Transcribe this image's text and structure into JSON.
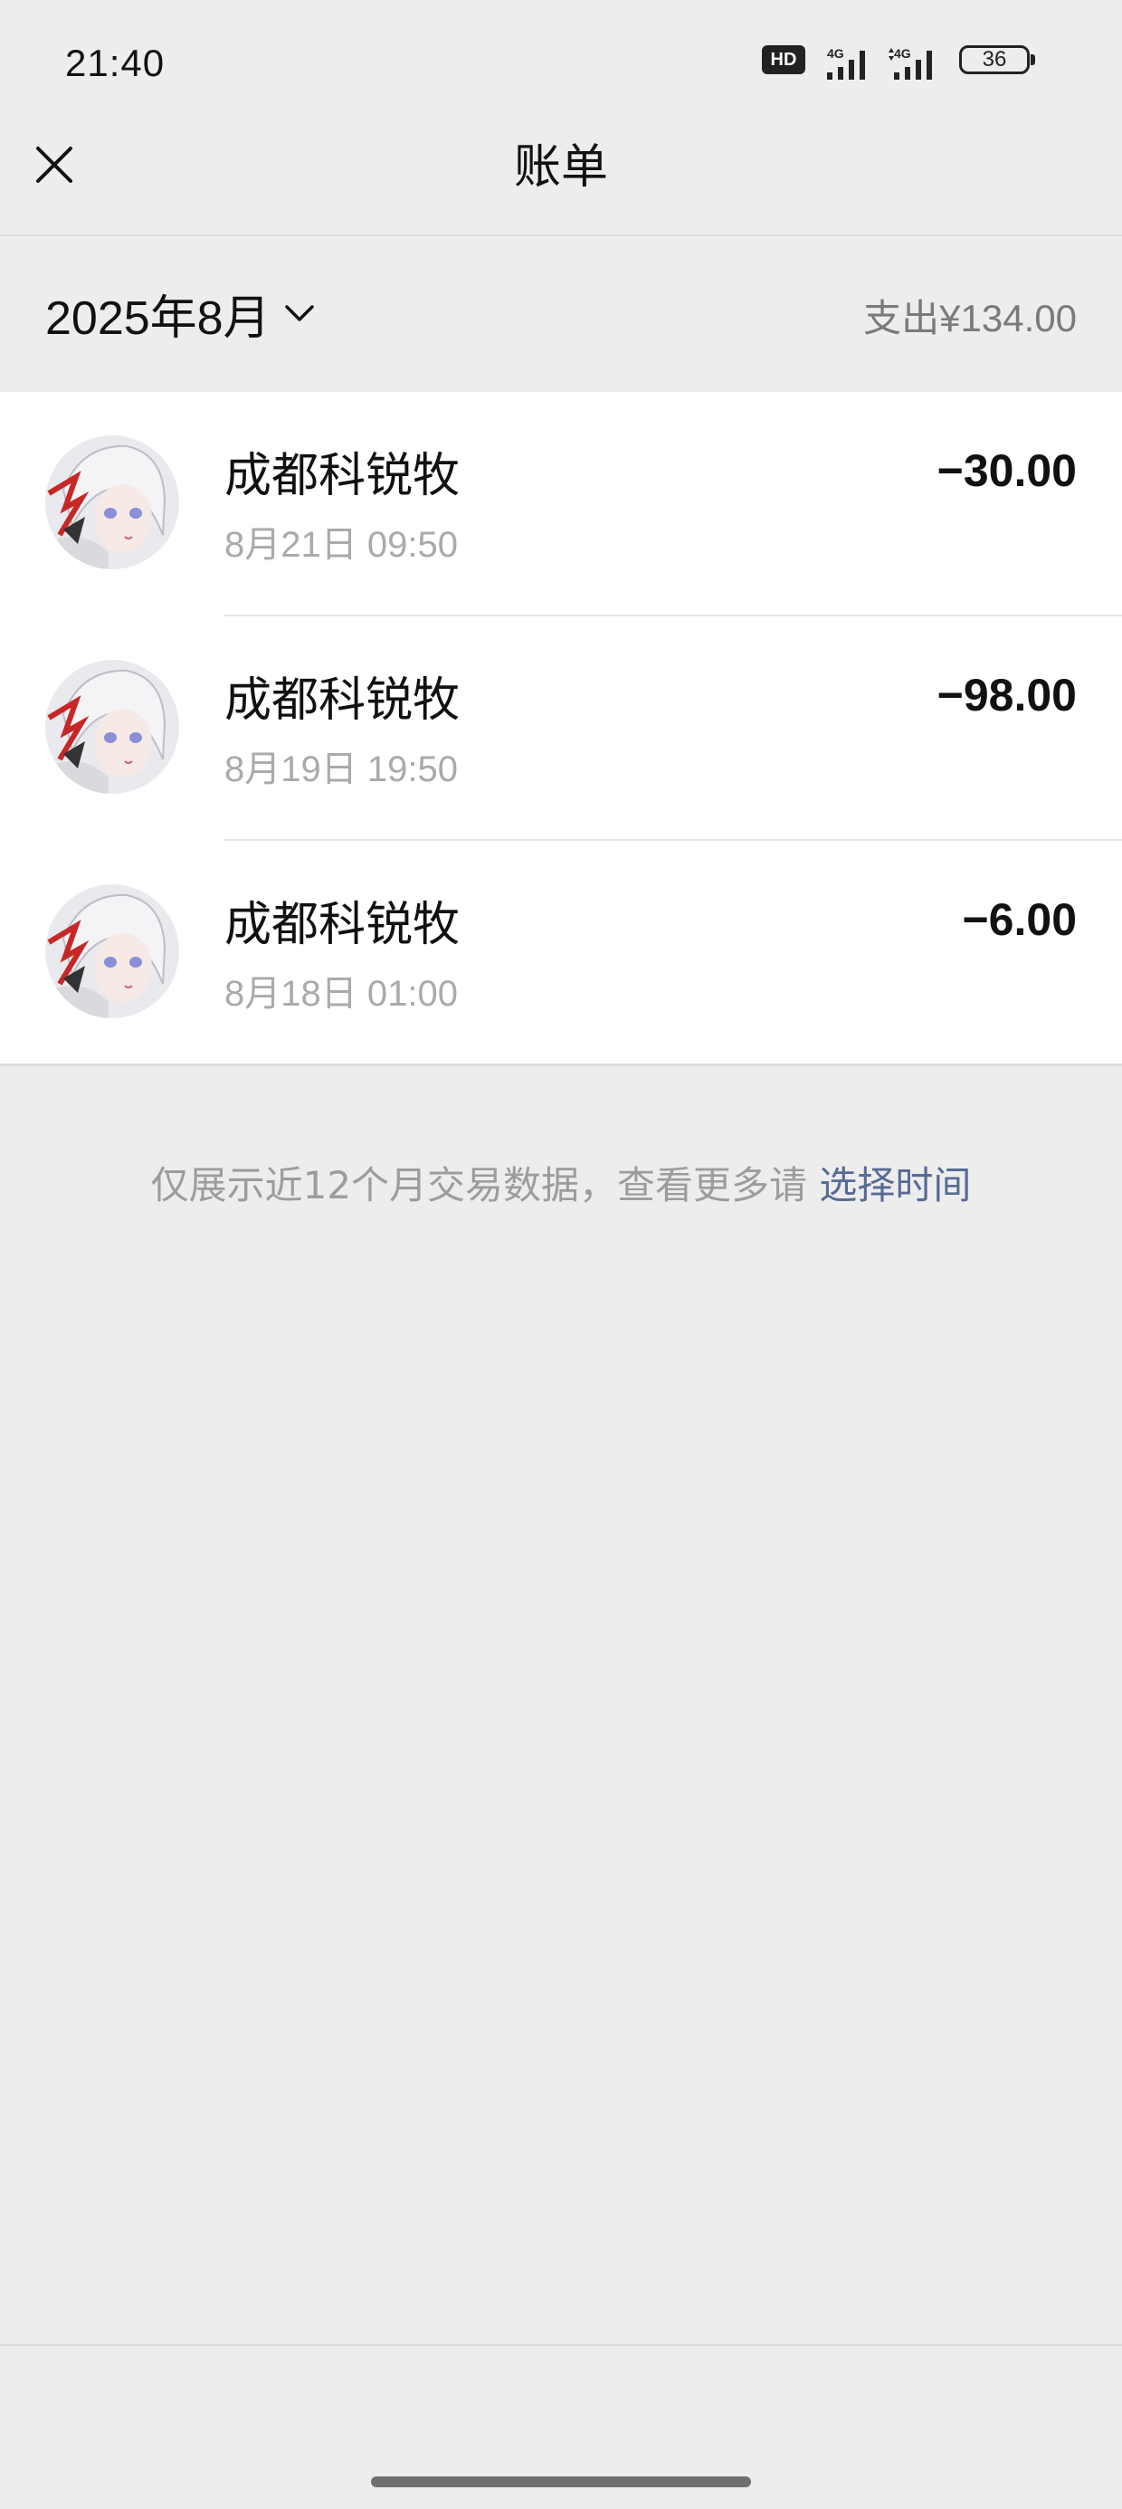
{
  "status_bar": {
    "time": "21:40",
    "hd_label": "HD",
    "signal_1_label": "4G",
    "signal_2_label": "4G",
    "battery_level": "36"
  },
  "nav": {
    "title": "账单",
    "close_icon": "close-icon"
  },
  "summary": {
    "month": "2025年8月",
    "expense_text": "支出¥134.00"
  },
  "transactions": [
    {
      "merchant": "成都科锐牧",
      "datetime": "8月21日 09:50",
      "amount": "−30.00"
    },
    {
      "merchant": "成都科锐牧",
      "datetime": "8月19日 19:50",
      "amount": "−98.00"
    },
    {
      "merchant": "成都科锐牧",
      "datetime": "8月18日 01:00",
      "amount": "−6.00"
    }
  ],
  "footer": {
    "note": "仅展示近12个月交易数据，查看更多请 ",
    "link": "选择时间"
  },
  "colors": {
    "background": "#ededed",
    "link": "#576b95",
    "secondary_text": "#9c9c9c"
  }
}
